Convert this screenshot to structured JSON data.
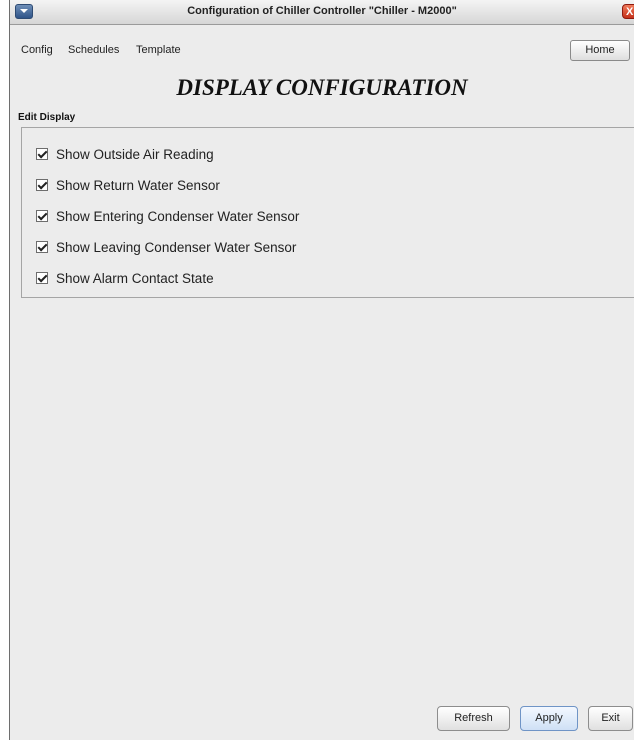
{
  "window": {
    "title": "Configuration of Chiller Controller \"Chiller - M2000\"",
    "close_label": "X"
  },
  "menu": {
    "items": [
      "Config",
      "Schedules",
      "Template"
    ],
    "home_label": "Home"
  },
  "page": {
    "title": "DISPLAY CONFIGURATION",
    "section_label": "Edit Display"
  },
  "options": [
    {
      "label": "Show Outside Air Reading",
      "checked": true
    },
    {
      "label": "Show Return Water Sensor",
      "checked": true
    },
    {
      "label": "Show Entering Condenser Water Sensor",
      "checked": true
    },
    {
      "label": "Show Leaving Condenser Water Sensor",
      "checked": true
    },
    {
      "label": "Show Alarm Contact State",
      "checked": true
    }
  ],
  "footer": {
    "refresh_label": "Refresh",
    "apply_label": "Apply",
    "exit_label": "Exit"
  }
}
